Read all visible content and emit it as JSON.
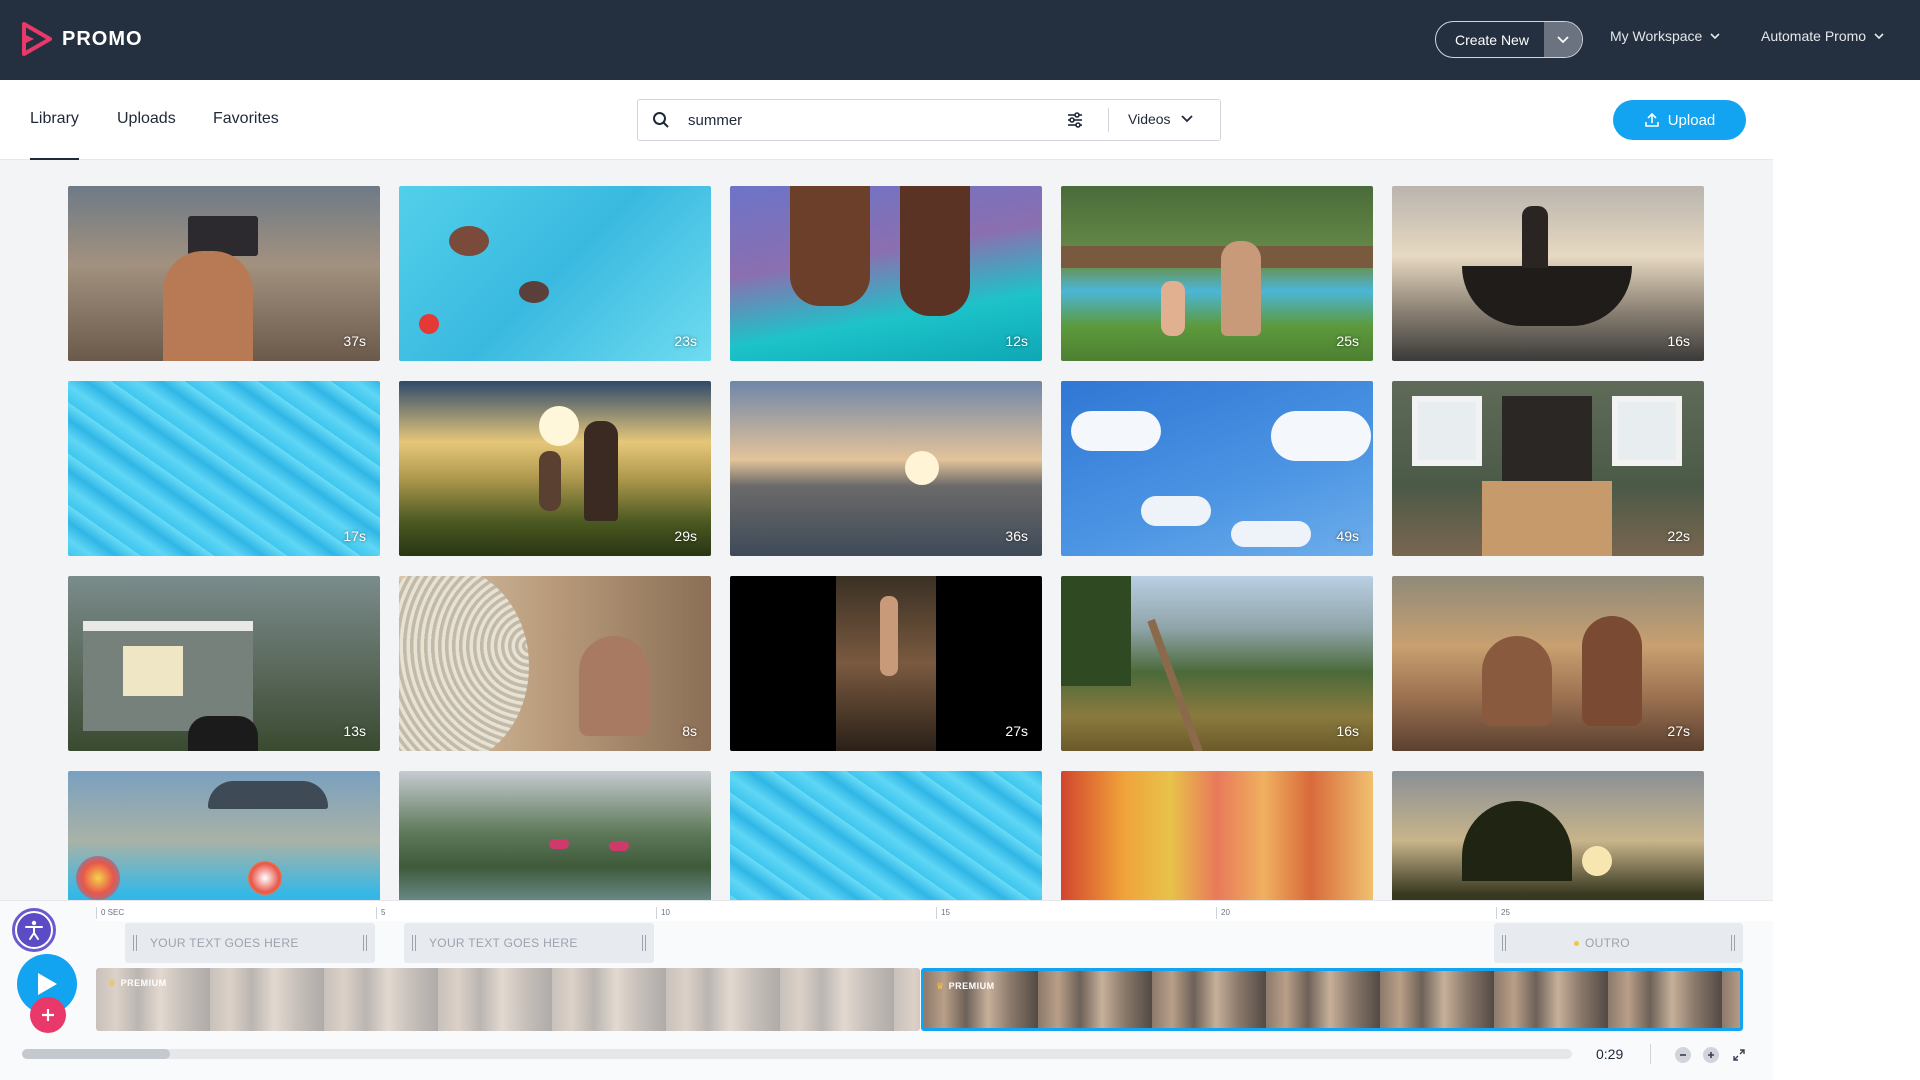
{
  "app": {
    "logo_text": "PROMO"
  },
  "topbar": {
    "create_new_label": "Create New",
    "workspace_label": "My Workspace",
    "automate_label": "Automate Promo"
  },
  "tabs": [
    {
      "label": "Library",
      "active": true
    },
    {
      "label": "Uploads",
      "active": false
    },
    {
      "label": "Favorites",
      "active": false
    }
  ],
  "search": {
    "value": "summer",
    "type_label": "Videos"
  },
  "upload_label": "Upload",
  "thumbnails": [
    {
      "subject": "festival-crowd",
      "duration": "37s"
    },
    {
      "subject": "pool-swimmers",
      "duration": "23s"
    },
    {
      "subject": "paddleboard",
      "duration": "12s"
    },
    {
      "subject": "backyard-pool",
      "duration": "25s"
    },
    {
      "subject": "boat-sunset",
      "duration": "16s"
    },
    {
      "subject": "pool-water",
      "duration": "17s"
    },
    {
      "subject": "field-sunset-running",
      "duration": "29s"
    },
    {
      "subject": "ocean-sunset",
      "duration": "36s"
    },
    {
      "subject": "blue-sky-clouds",
      "duration": "49s"
    },
    {
      "subject": "porch-couple",
      "duration": "22s"
    },
    {
      "subject": "backyard-house",
      "duration": "13s"
    },
    {
      "subject": "fan-woman",
      "duration": "8s"
    },
    {
      "subject": "concert-hands",
      "duration": "27s"
    },
    {
      "subject": "hill-trail",
      "duration": "16s"
    },
    {
      "subject": "festival-dancers",
      "duration": "27s"
    },
    {
      "subject": "pool-party",
      "duration": ""
    },
    {
      "subject": "mountain-lake-kayak",
      "duration": ""
    },
    {
      "subject": "pool-water-2",
      "duration": ""
    },
    {
      "subject": "colorful-houses",
      "duration": ""
    },
    {
      "subject": "sunset-trees",
      "duration": ""
    }
  ],
  "timeline": {
    "ticks": [
      "0 SEC",
      "5",
      "10",
      "15",
      "20",
      "25"
    ],
    "text_tracks": [
      "YOUR TEXT GOES HERE",
      "YOUR TEXT GOES HERE"
    ],
    "outro_label": "OUTRO",
    "clip_badge": "PREMIUM",
    "time": "0:29"
  },
  "colors": {
    "topbar": "#243040",
    "accent": "#12a4f0",
    "add": "#e8396a",
    "accessibility": "#5b4bc4"
  }
}
